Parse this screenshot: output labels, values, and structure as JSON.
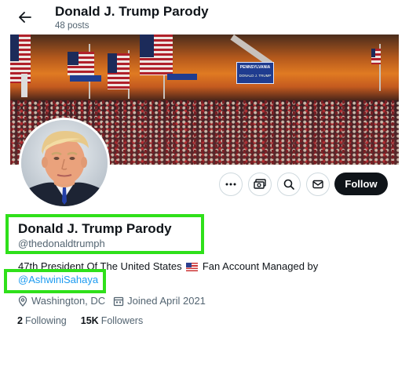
{
  "header": {
    "title": "Donald J. Trump Parody",
    "posts_count": "48 posts",
    "back_icon": "arrow-left-icon"
  },
  "banner": {
    "signs": [
      "PENNSYLVANIA",
      "DONALD J. TRUMP"
    ]
  },
  "actions": {
    "more_icon": "more-horizontal-icon",
    "subscribe_icon": "money-subscribe-icon",
    "search_icon": "search-icon",
    "message_icon": "envelope-icon",
    "follow_label": "Follow"
  },
  "profile": {
    "name": "Donald J. Trump Parody",
    "handle": "@thedonaldtrumph",
    "bio_before": "47th President Of The United States",
    "bio_after": "Fan Account Managed by",
    "mention": "@AshwiniSahaya",
    "location": "Washington, DC",
    "joined": "Joined April 2021",
    "following_count": "2",
    "following_label": "Following",
    "followers_count": "15K",
    "followers_label": "Followers"
  },
  "highlight_color": "#2fe01a",
  "accent_color": "#1d9bf0"
}
